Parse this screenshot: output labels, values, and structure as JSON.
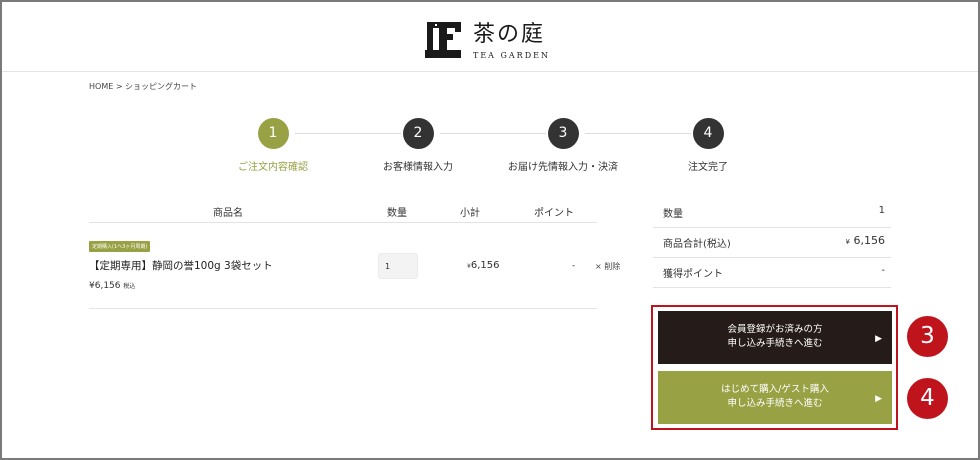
{
  "header": {
    "logo_jp": "茶の庭",
    "logo_en": "TEA GARDEN"
  },
  "breadcrumb": "HOME > ショッピングカート",
  "steps": [
    {
      "num": "1",
      "label": "ご注文内容確認",
      "active": true
    },
    {
      "num": "2",
      "label": "お客様情報入力",
      "active": false
    },
    {
      "num": "3",
      "label": "お届け先情報入力・決済",
      "active": false
    },
    {
      "num": "4",
      "label": "注文完了",
      "active": false
    }
  ],
  "cart": {
    "headers": {
      "product": "商品名",
      "quantity": "数量",
      "subtotal": "小計",
      "points": "ポイント"
    },
    "item": {
      "badge": "定期購入(1ヘ3ヶ月周期)",
      "name": "【定期専用】静岡の誉100g 3袋セット",
      "price": "¥6,156",
      "tax_label": "税込",
      "quantity": "1",
      "subtotal_yen": "¥",
      "subtotal_value": "6,156",
      "points": "-",
      "delete_label": "× 削除"
    }
  },
  "summary": {
    "rows": [
      {
        "label": "数量",
        "value": "1"
      },
      {
        "label": "商品合計(税込)",
        "value_yen": "¥",
        "value": "6,156"
      },
      {
        "label": "獲得ポイント",
        "value": "-"
      }
    ]
  },
  "buttons": {
    "member_line1": "会員登録がお済みの方",
    "member_line2": "申し込み手続きへ進む",
    "guest_line1": "はじめて購入/ゲスト購入",
    "guest_line2": "申し込み手続きへ進む",
    "arrow": "▶"
  },
  "annotations": {
    "badge3": "3",
    "badge4": "4"
  },
  "colors": {
    "accent_green": "#98a244",
    "dark": "#251c1a",
    "annotation_red": "#c0141d"
  }
}
